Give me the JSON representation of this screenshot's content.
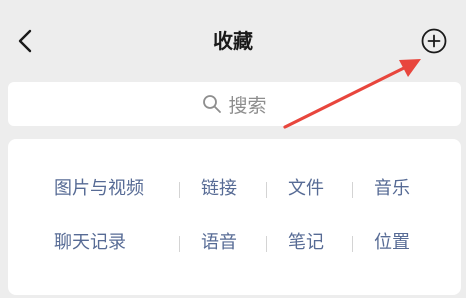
{
  "header": {
    "title": "收藏",
    "back_icon": "chevron-left-icon",
    "add_icon": "plus-circle-icon"
  },
  "search": {
    "placeholder": "搜索",
    "icon": "search-icon"
  },
  "annotation": {
    "arrow_color": "#e8463d"
  },
  "categories": {
    "row1": [
      "图片与视频",
      "链接",
      "文件",
      "音乐"
    ],
    "row2": [
      "聊天记录",
      "语音",
      "笔记",
      "位置"
    ]
  },
  "colors": {
    "background": "#ededed",
    "card": "#ffffff",
    "link": "#576b95",
    "title": "#1a1a1a",
    "placeholder": "#8e8e8e"
  }
}
